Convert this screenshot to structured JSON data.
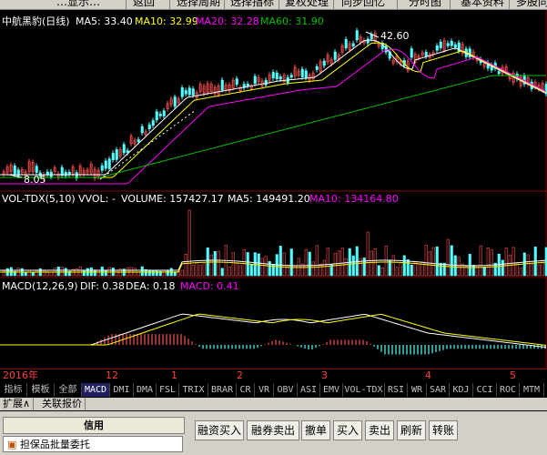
{
  "toolbar": {
    "items": [
      "…显示…",
      "返回",
      "选择周期",
      "选择指标",
      "复权处理",
      "同步回忆",
      "分时图",
      "基本资料",
      "多股同列"
    ]
  },
  "main": {
    "title": "中航黑豹(日线)",
    "ma5": "MA5: 33.40",
    "ma10": "MA10: 32.99",
    "ma20": "MA20: 32.28",
    "ma60": "MA60: 31.90",
    "high_label": "42.60",
    "low_label": "8.05"
  },
  "volume": {
    "header": "VOL-TDX(5,10)",
    "vvol": "VVOL: -",
    "volume": "VOLUME: 157427.17",
    "ma5": "MA5: 149491.20",
    "ma10": "MA10: 134164.80"
  },
  "macd": {
    "header": "MACD(12,26,9)",
    "dif": "DIF: 0.38",
    "dea": "DEA: 0.18",
    "macd": "MACD: 0.41"
  },
  "xaxis": {
    "labels": [
      "2016年",
      "12",
      "1",
      "2",
      "3",
      "4",
      "5"
    ]
  },
  "indicators": [
    "指标",
    "模板",
    "全部",
    "MACD",
    "DMI",
    "DMA",
    "FSL",
    "TRIX",
    "BRAR",
    "CR",
    "VR",
    "OBV",
    "ASI",
    "EMV",
    "VOL-TDX",
    "RSI",
    "WR",
    "SAR",
    "KDJ",
    "CCI",
    "ROC",
    "MTM"
  ],
  "tabs2": [
    "扩展∧",
    "关联报价"
  ],
  "trade": {
    "section": "信用",
    "item": "担保品批量委托",
    "buttons": [
      "融资买入",
      "融券卖出",
      "撤单",
      "买入",
      "卖出",
      "刷新",
      "转账"
    ]
  },
  "colors": {
    "up": "#ff5050",
    "down": "#54ffff",
    "ma5": "#ffffff",
    "ma10": "#ffff00",
    "ma20": "#ff00ff",
    "ma60": "#00c000"
  }
}
